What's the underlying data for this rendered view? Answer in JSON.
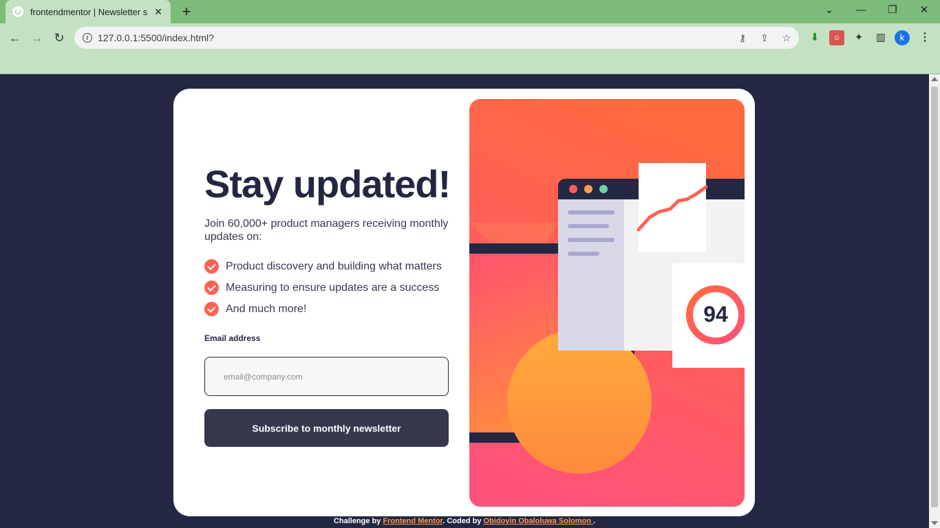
{
  "browser": {
    "tab_title": "frontendmentor | Newsletter sig",
    "url": "127.0.0.1:5500/index.html?",
    "profile_initial": "k"
  },
  "page": {
    "headline": "Stay updated!",
    "intro": "Join 60,000+ product managers receiving monthly updates on:",
    "features": [
      "Product discovery and building what matters",
      "Measuring to ensure updates are a success",
      "And much more!"
    ],
    "email_label": "Email address",
    "email_placeholder": "email@company.com",
    "subscribe_label": "Subscribe to monthly newsletter",
    "illustration_score": "94"
  },
  "footer": {
    "prefix": "Challenge by ",
    "link1": "Frontend Mentor",
    "middle": ". Coded by ",
    "link2": "Obidoyin Obaloluwa Solomon ",
    "suffix": "."
  },
  "colors": {
    "page_bg": "#242742",
    "accent": "#ff6155",
    "button_bg": "#36384e",
    "browser_green": "#7dbb7a"
  },
  "icons": [
    "check-icon",
    "back-icon",
    "forward-icon",
    "reload-icon",
    "star-icon",
    "puzzle-icon",
    "key-icon",
    "share-icon"
  ]
}
